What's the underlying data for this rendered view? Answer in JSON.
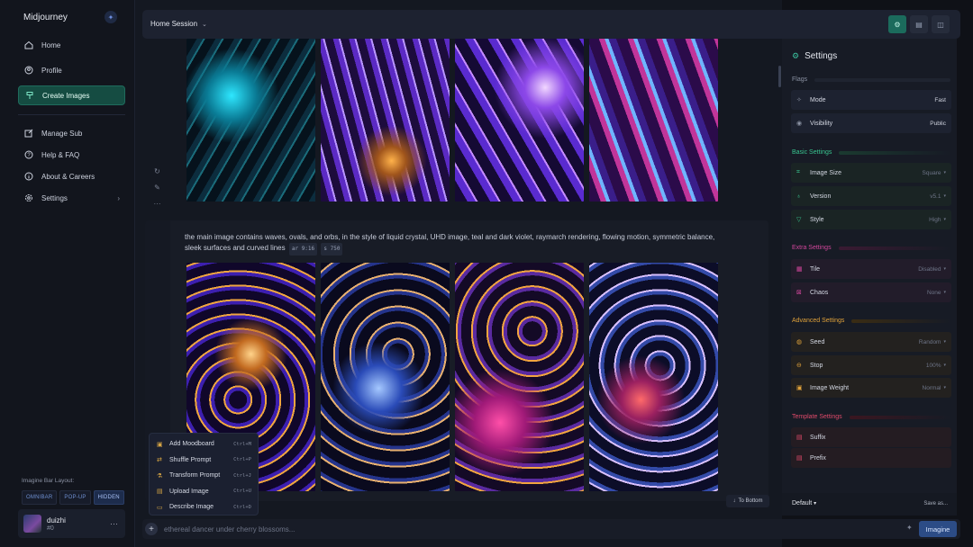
{
  "sidebar": {
    "brand": "Midjourney",
    "items": [
      {
        "label": "Home"
      },
      {
        "label": "Profile"
      },
      {
        "label": "Create Images"
      },
      {
        "label": "Manage Sub"
      },
      {
        "label": "Help & FAQ"
      },
      {
        "label": "About & Careers"
      },
      {
        "label": "Settings"
      }
    ],
    "layout_label": "Imagine Bar Layout:",
    "layout_options": [
      "OMNIBAR",
      "POP-UP",
      "HIDDEN"
    ],
    "layout_selected": "HIDDEN",
    "user": {
      "name": "duizhi",
      "tag": "#0"
    }
  },
  "header": {
    "session": "Home Session"
  },
  "job": {
    "prompt": "the main image contains waves, ovals, and orbs, in the style of liquid crystal, UHD image, teal and dark violet, raymarch rendering, flowing motion, symmetric balance, sleek surfaces and curved lines",
    "params": [
      "ar 9:16",
      "s 750"
    ]
  },
  "menu": {
    "items": [
      {
        "label": "Add Moodboard",
        "shortcut": "Ctrl+M"
      },
      {
        "label": "Shuffle Prompt",
        "shortcut": "Ctrl+P"
      },
      {
        "label": "Transform Prompt",
        "shortcut": "Ctrl+J"
      },
      {
        "label": "Upload Image",
        "shortcut": "Ctrl+U"
      },
      {
        "label": "Describe Image",
        "shortcut": "Ctrl+D"
      }
    ]
  },
  "to_bottom": "To Bottom",
  "input": {
    "placeholder": "ethereal dancer under cherry blossoms...",
    "submit": "Imagine"
  },
  "settings": {
    "title": "Settings",
    "sections": {
      "flags": "Flags",
      "basic": "Basic Settings",
      "extra": "Extra Settings",
      "advanced": "Advanced Settings",
      "template": "Template Settings"
    },
    "options": {
      "mode": {
        "label": "Mode",
        "value": "Fast"
      },
      "visibility": {
        "label": "Visibility",
        "value": "Public"
      },
      "image_size": {
        "label": "Image Size",
        "value": "Square"
      },
      "version": {
        "label": "Version",
        "value": "v5.1"
      },
      "style": {
        "label": "Style",
        "value": "High"
      },
      "tile": {
        "label": "Tile",
        "value": "Disabled"
      },
      "chaos": {
        "label": "Chaos",
        "value": "None"
      },
      "seed": {
        "label": "Seed",
        "value": "Random"
      },
      "stop": {
        "label": "Stop",
        "value": "100%"
      },
      "image_weight": {
        "label": "Image Weight",
        "value": "Normal"
      },
      "suffix": {
        "label": "Suffix"
      },
      "prefix": {
        "label": "Prefix"
      }
    },
    "preset": "Default",
    "save_as": "Save as..."
  },
  "colors": {
    "accent_green": "#3bc4a0",
    "basic": "#38c48f",
    "extra": "#d2469c",
    "advanced": "#e0a23a",
    "template": "#e04a6a",
    "imagine": "#2c4c86"
  }
}
